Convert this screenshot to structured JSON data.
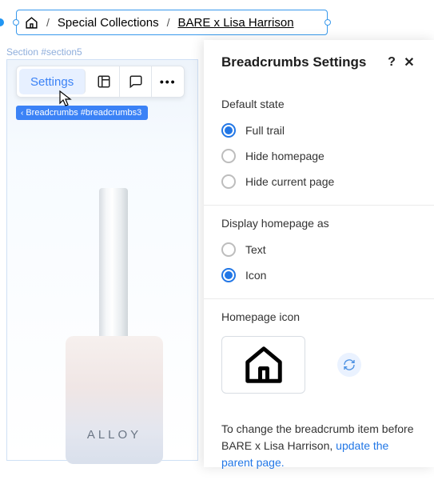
{
  "section_label": "Section #section5",
  "breadcrumb": {
    "items": [
      {
        "label": "Special Collections"
      },
      {
        "label": "BARE x Lisa Harrison",
        "current": true
      }
    ],
    "separator": "/",
    "tag": "Breadcrumbs #breadcrumbs3"
  },
  "toolbar": {
    "settings_label": "Settings"
  },
  "product": {
    "brand_snippet": "ALLOY"
  },
  "panel": {
    "title": "Breadcrumbs Settings",
    "help": "?",
    "close": "✕",
    "sections": {
      "default_state": {
        "title": "Default state",
        "options": [
          {
            "label": "Full trail",
            "checked": true
          },
          {
            "label": "Hide homepage",
            "checked": false
          },
          {
            "label": "Hide current page",
            "checked": false
          }
        ]
      },
      "display_homepage": {
        "title": "Display homepage as",
        "options": [
          {
            "label": "Text",
            "checked": false
          },
          {
            "label": "Icon",
            "checked": true
          }
        ]
      },
      "homepage_icon": {
        "title": "Homepage icon"
      }
    },
    "note_pre": "To change the breadcrumb item before BARE x Lisa Harrison, ",
    "note_link": "update the parent page."
  }
}
